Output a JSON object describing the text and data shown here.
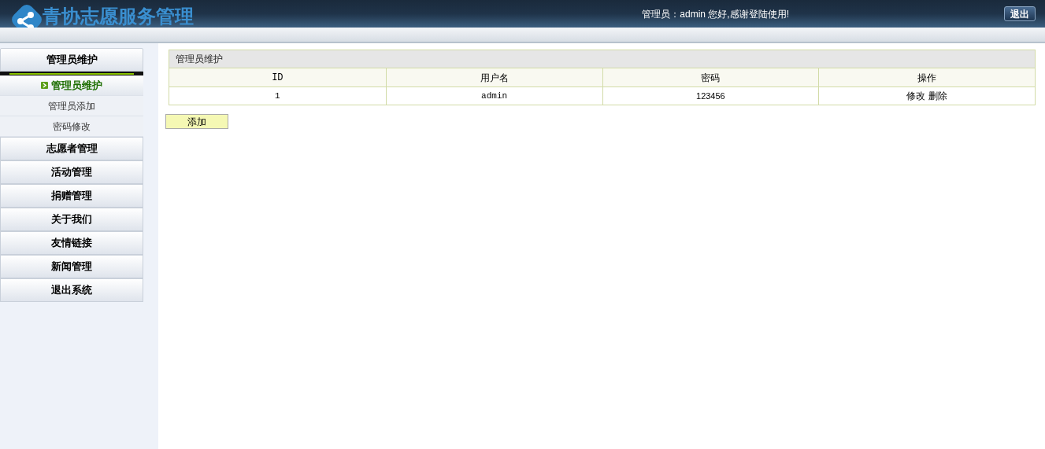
{
  "header": {
    "title": "青协志愿服务管理",
    "greeting_label": "管理员：",
    "user": "admin",
    "greeting": "您好,感谢登陆使用!",
    "logout": "退出"
  },
  "sidebar": [
    {
      "label": "管理员维护",
      "expanded": true,
      "children": [
        {
          "label": "管理员维护",
          "selected": true
        },
        {
          "label": "管理员添加",
          "selected": false
        },
        {
          "label": "密码修改",
          "selected": false
        }
      ]
    },
    {
      "label": "志愿者管理",
      "expanded": false
    },
    {
      "label": "活动管理",
      "expanded": false
    },
    {
      "label": "捐赠管理",
      "expanded": false
    },
    {
      "label": "关于我们",
      "expanded": false
    },
    {
      "label": "友情链接",
      "expanded": false
    },
    {
      "label": "新闻管理",
      "expanded": false
    },
    {
      "label": "退出系统",
      "expanded": false
    }
  ],
  "table": {
    "caption": "管理员维护",
    "columns": [
      "ID",
      "用户名",
      "密码",
      "操作"
    ],
    "rows": [
      {
        "id": "1",
        "username": "admin",
        "password": "123456",
        "actions": [
          "修改",
          "删除"
        ]
      }
    ]
  },
  "add_button": "添加"
}
